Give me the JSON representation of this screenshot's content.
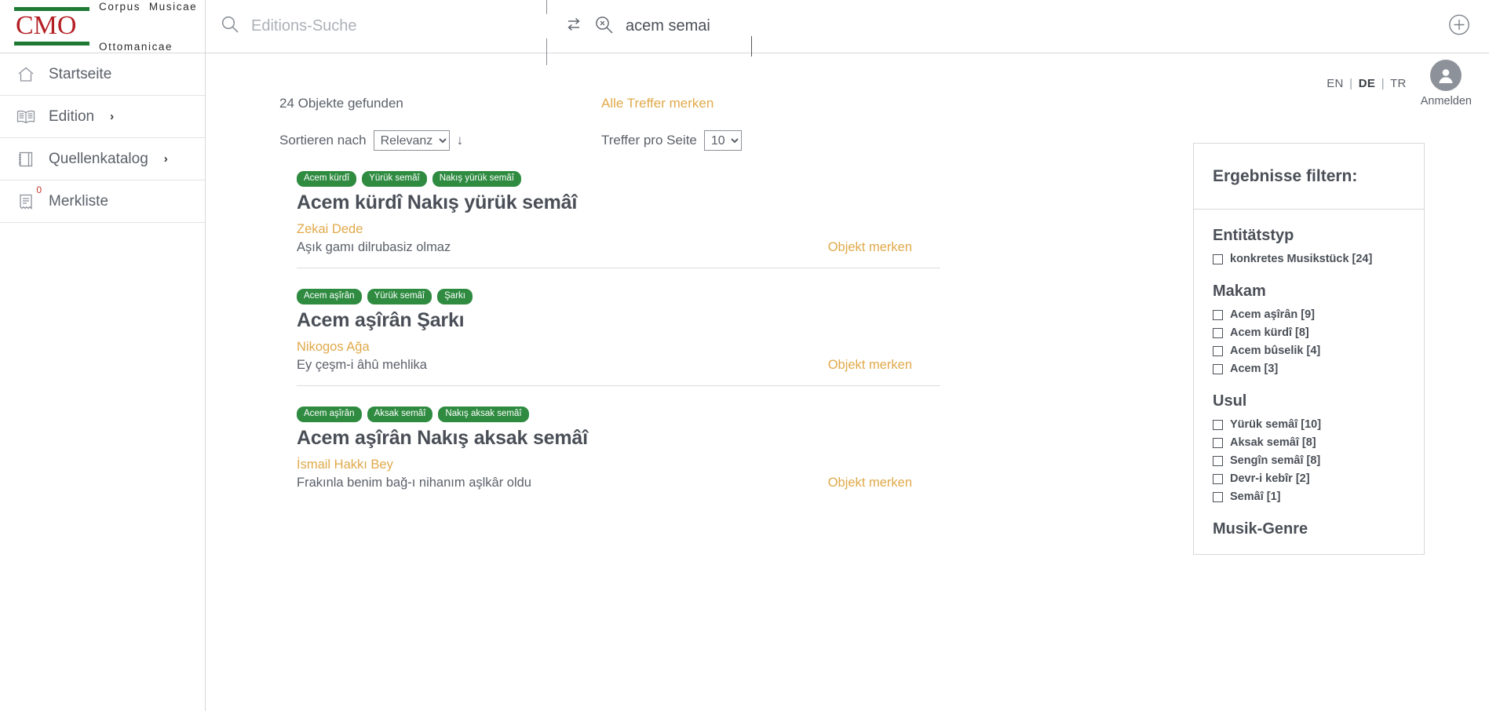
{
  "brand": {
    "acronym": "CMO",
    "line1": "Corpus  Musicae",
    "line2": "Ottomanicae"
  },
  "sidebar": {
    "items": [
      {
        "label": "Startseite",
        "icon": "home-icon",
        "chevron": "",
        "badge": null
      },
      {
        "label": "Edition",
        "icon": "book-open-icon",
        "chevron": "›",
        "badge": null
      },
      {
        "label": "Quellenkatalog",
        "icon": "notebook-icon",
        "chevron": "›",
        "badge": null
      },
      {
        "label": "Merkliste",
        "icon": "bookmark-list-icon",
        "chevron": "",
        "badge": "0"
      }
    ]
  },
  "header": {
    "search_placeholder": "Editions-Suche",
    "search_icon": "magnifier-icon",
    "swap_icon": "swap-arrows-icon",
    "clear_search_icon": "magnifier-clear-icon",
    "search_term": "acem semai",
    "add_icon": "plus-circle-icon"
  },
  "account": {
    "languages": [
      {
        "code": "EN",
        "active": false
      },
      {
        "code": "DE",
        "active": true
      },
      {
        "code": "TR",
        "active": false
      }
    ],
    "separator": "|",
    "avatar_icon": "user-avatar-icon",
    "login_label": "Anmelden"
  },
  "results_meta": {
    "found": "24 Objekte gefunden",
    "bookmark_all": "Alle Treffer merken",
    "sort_label": "Sortieren nach",
    "sort_value": "Relevanz",
    "sort_options": [
      "Relevanz"
    ],
    "sort_direction_icon": "↓",
    "per_page_label": "Treffer pro Seite",
    "per_page_value": "10",
    "per_page_options": [
      "10"
    ]
  },
  "results": [
    {
      "tags": [
        "Acem kürdî",
        "Yürük semâî",
        "Nakış yürük semâî"
      ],
      "title": "Acem kürdî Nakış yürük semâî",
      "composer": "Zekai Dede",
      "incipit": "Aşık gamı dilrubasiz olmaz",
      "bookmark": "Objekt merken"
    },
    {
      "tags": [
        "Acem aşîrân",
        "Yürük semâî",
        "Şarkı"
      ],
      "title": "Acem aşîrân Şarkı",
      "composer": "Nikogos Ağa",
      "incipit": "Ey çeşm-i âhû mehlika",
      "bookmark": "Objekt merken"
    },
    {
      "tags": [
        "Acem aşîrân",
        "Aksak semâî",
        "Nakış aksak semâî"
      ],
      "title": "Acem aşîrân Nakış aksak semâî",
      "composer": "İsmail Hakkı Bey",
      "incipit": "Frakınla benim bağ-ı nihanım aşlkâr oldu",
      "bookmark": "Objekt merken"
    }
  ],
  "filters": {
    "heading": "Ergebnisse filtern:",
    "groups": [
      {
        "title": "Entitätstyp",
        "options": [
          {
            "label": "konkretes Musikstück [24]",
            "checked": false
          }
        ]
      },
      {
        "title": "Makam",
        "options": [
          {
            "label": "Acem aşîrân [9]",
            "checked": false
          },
          {
            "label": "Acem kürdî [8]",
            "checked": false
          },
          {
            "label": "Acem bûselik [4]",
            "checked": false
          },
          {
            "label": "Acem [3]",
            "checked": false
          }
        ]
      },
      {
        "title": "Usul",
        "options": [
          {
            "label": "Yürük semâî [10]",
            "checked": false
          },
          {
            "label": "Aksak semâî [8]",
            "checked": false
          },
          {
            "label": "Sengîn semâî [8]",
            "checked": false
          },
          {
            "label": "Devr-i kebîr [2]",
            "checked": false
          },
          {
            "label": "Semâî [1]",
            "checked": false
          }
        ]
      },
      {
        "title": "Musik-Genre",
        "options": []
      }
    ]
  },
  "colors": {
    "brand_red": "#b41f24",
    "brand_green": "#1f7a34",
    "tag_green": "#2e8b40",
    "accent_gold": "#e0a94a",
    "text": "#4a4f57"
  }
}
